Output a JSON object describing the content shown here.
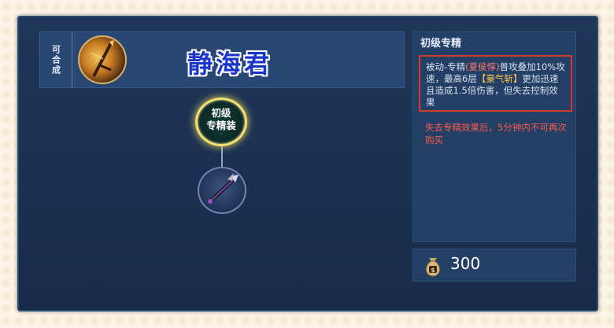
{
  "header": {
    "craftable_label": "可合成",
    "hero_name": "静海君"
  },
  "tree": {
    "top_node": {
      "line1": "初级",
      "line2": "专精装",
      "tiny": "·"
    },
    "bottom_node_icon": "trident-weapon-icon"
  },
  "info": {
    "title": "初级专精",
    "desc_prefix": "被动-专精",
    "desc_hero": "(夏侯惇)",
    "desc_mid": "普攻叠加10%攻速，最高6层",
    "desc_skill": "【豪气斩】",
    "desc_suffix": "更加迅速且造成1.5倍伤害，但失去控制效果",
    "warning": "失去专精效果后，5分钟内不可再次购买"
  },
  "price": {
    "icon": "money-bag-icon",
    "value": "300"
  },
  "colors": {
    "panel_bg": "#1f3658",
    "highlight_red": "#ff7a6a",
    "highlight_gold": "#ffc94d",
    "warning": "#ff5a4a",
    "hero_name": "#1a36c8"
  }
}
